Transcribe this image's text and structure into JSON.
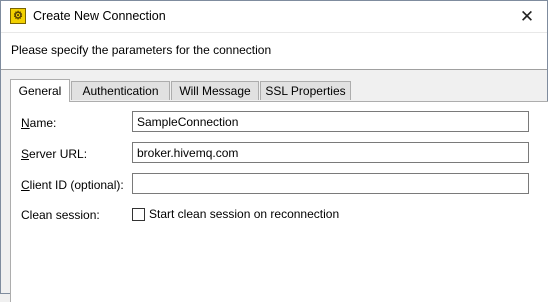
{
  "window": {
    "title": "Create New Connection",
    "close_glyph": "✕",
    "app_icon_glyph": "⚙"
  },
  "header": {
    "text": "Please specify the parameters for the connection"
  },
  "tabs": [
    {
      "label": "General",
      "active": true
    },
    {
      "label": "Authentication",
      "active": false
    },
    {
      "label": "Will Message",
      "active": false
    },
    {
      "label": "SSL Properties",
      "active": false
    }
  ],
  "form": {
    "name": {
      "label_mnemonic": "N",
      "label_rest": "ame:",
      "value": "SampleConnection"
    },
    "server_url": {
      "label_mnemonic": "S",
      "label_rest": "erver URL:",
      "value": "broker.hivemq.com"
    },
    "client_id": {
      "label_mnemonic": "C",
      "label_rest": "lient ID (optional):",
      "value": ""
    },
    "clean_session": {
      "label": "Clean session:",
      "checkbox_label": "Start clean session on reconnection",
      "checked": false
    }
  }
}
